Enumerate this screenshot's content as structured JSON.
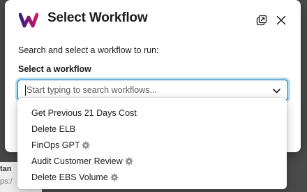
{
  "modal": {
    "title": "Select Workflow",
    "description": "Search and select a workflow to run:",
    "field_label": "Select a workflow",
    "search_placeholder": "Start typing to search workflows...",
    "popout_icon": "open-in-window-icon",
    "close_icon": "close-icon",
    "logo_icon": "workflow-logo-icon",
    "accent_color": "#1264a3"
  },
  "dropdown": {
    "options": [
      {
        "label": "Get Previous 21 Days Cost",
        "has_gear": false
      },
      {
        "label": "Delete ELB",
        "has_gear": false
      },
      {
        "label": "FinOps GPT",
        "has_gear": true
      },
      {
        "label": "Audit Customer Review",
        "has_gear": true
      },
      {
        "label": "Delete EBS Volume",
        "has_gear": true
      }
    ]
  },
  "background": {
    "fragment_1": "tan",
    "fragment_2": "ps:/"
  }
}
